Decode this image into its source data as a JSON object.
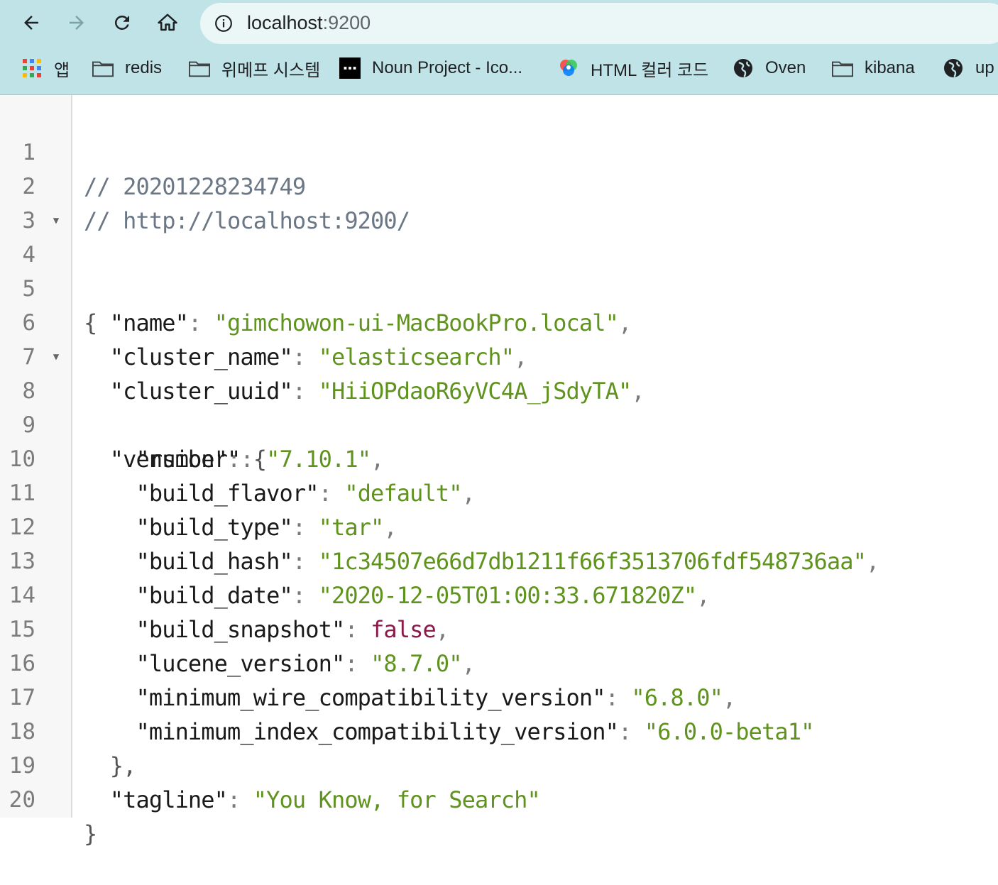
{
  "browser": {
    "url_host": "localhost",
    "url_port": ":9200",
    "bookmarks": [
      {
        "label": "앱",
        "icon": "apps-grid-icon"
      },
      {
        "label": "redis",
        "icon": "folder-icon"
      },
      {
        "label": "위메프 시스템",
        "icon": "folder-icon"
      },
      {
        "label": "Noun Project - Ico...",
        "icon": "noun-project-icon"
      },
      {
        "label": "HTML 컬러 코드",
        "icon": "color-wheel-icon"
      },
      {
        "label": "Oven",
        "icon": "globe-icon"
      },
      {
        "label": "kibana",
        "icon": "folder-icon"
      },
      {
        "label": "up",
        "icon": "globe-icon"
      }
    ]
  },
  "viewer": {
    "line_numbers": [
      "1",
      "2",
      "3",
      "4",
      "5",
      "6",
      "7",
      "8",
      "9",
      "10",
      "11",
      "12",
      "13",
      "14",
      "15",
      "16",
      "17",
      "18",
      "19",
      "20"
    ],
    "comment_timestamp": "// 20201228234749",
    "comment_url": "// http://localhost:9200/",
    "json": {
      "name": {
        "key": "\"name\"",
        "value": "\"gimchowon-ui-MacBookPro.local\""
      },
      "cluster_name": {
        "key": "\"cluster_name\"",
        "value": "\"elasticsearch\""
      },
      "cluster_uuid": {
        "key": "\"cluster_uuid\"",
        "value": "\"HiiOPdaoR6yVC4A_jSdyTA\""
      },
      "version_key": "\"version\"",
      "version": {
        "number": {
          "key": "\"number\"",
          "value": "\"7.10.1\""
        },
        "build_flavor": {
          "key": "\"build_flavor\"",
          "value": "\"default\""
        },
        "build_type": {
          "key": "\"build_type\"",
          "value": "\"tar\""
        },
        "build_hash": {
          "key": "\"build_hash\"",
          "value": "\"1c34507e66d7db1211f66f3513706fdf548736aa\""
        },
        "build_date": {
          "key": "\"build_date\"",
          "value": "\"2020-12-05T01:00:33.671820Z\""
        },
        "build_snapshot": {
          "key": "\"build_snapshot\"",
          "value": "false"
        },
        "lucene_version": {
          "key": "\"lucene_version\"",
          "value": "\"8.7.0\""
        },
        "minimum_wire_compatibility_version": {
          "key": "\"minimum_wire_compatibility_version\"",
          "value": "\"6.8.0\""
        },
        "minimum_index_compatibility_version": {
          "key": "\"minimum_index_compatibility_version\"",
          "value": "\"6.0.0-beta1\""
        }
      },
      "tagline": {
        "key": "\"tagline\"",
        "value": "\"You Know, for Search\""
      }
    },
    "punct": {
      "colon": ": ",
      "comma": ",",
      "open_brace": "{",
      "close_brace": "}",
      "close_brace_comma": "},",
      "fold_arrow": "▼"
    }
  },
  "colors": {
    "chrome_bg": "#bfe3e6",
    "string": "#5f931d",
    "boolean": "#8b1a4a",
    "comment": "#6b7785"
  }
}
